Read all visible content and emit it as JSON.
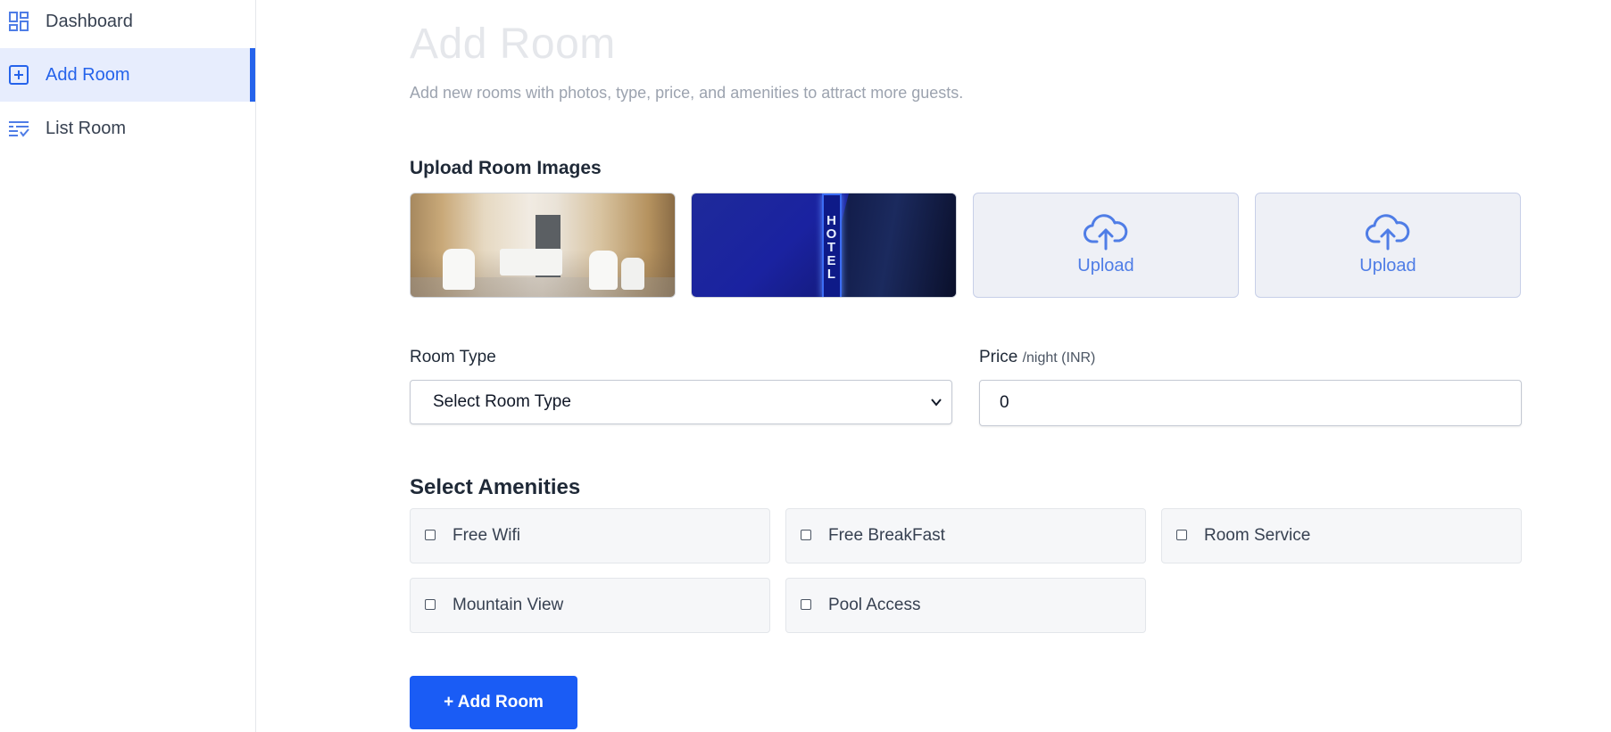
{
  "sidebar": {
    "items": [
      {
        "label": "Dashboard",
        "icon": "dashboard-icon"
      },
      {
        "label": "Add Room",
        "icon": "add-square-icon",
        "active": true
      },
      {
        "label": "List Room",
        "icon": "list-check-icon"
      }
    ]
  },
  "header": {
    "title": "Add Room",
    "subtitle": "Add new rooms with photos, type, price, and amenities to attract more guests."
  },
  "upload": {
    "label": "Upload Room Images",
    "slots": [
      {
        "type": "image",
        "icon": "photo-lobby"
      },
      {
        "type": "image",
        "icon": "photo-hotel-sign",
        "sign_text": "HOTEL"
      },
      {
        "type": "empty",
        "label": "Upload",
        "icon": "cloud-upload-icon"
      },
      {
        "type": "empty",
        "label": "Upload",
        "icon": "cloud-upload-icon"
      }
    ]
  },
  "room_type": {
    "label": "Room Type",
    "selected": "Select Room Type"
  },
  "price": {
    "label": "Price",
    "unit": "/night (INR)",
    "value": "0"
  },
  "amenities": {
    "label": "Select Amenities",
    "items": [
      {
        "label": "Free Wifi",
        "checked": false
      },
      {
        "label": "Free BreakFast",
        "checked": false
      },
      {
        "label": "Room Service",
        "checked": false
      },
      {
        "label": "Mountain View",
        "checked": false
      },
      {
        "label": "Pool Access",
        "checked": false
      }
    ]
  },
  "submit": {
    "label": "+ Add Room"
  },
  "colors": {
    "accent": "#1a5cf5",
    "active_bg": "#e7edfd",
    "upload_icon": "#4f7de6"
  }
}
